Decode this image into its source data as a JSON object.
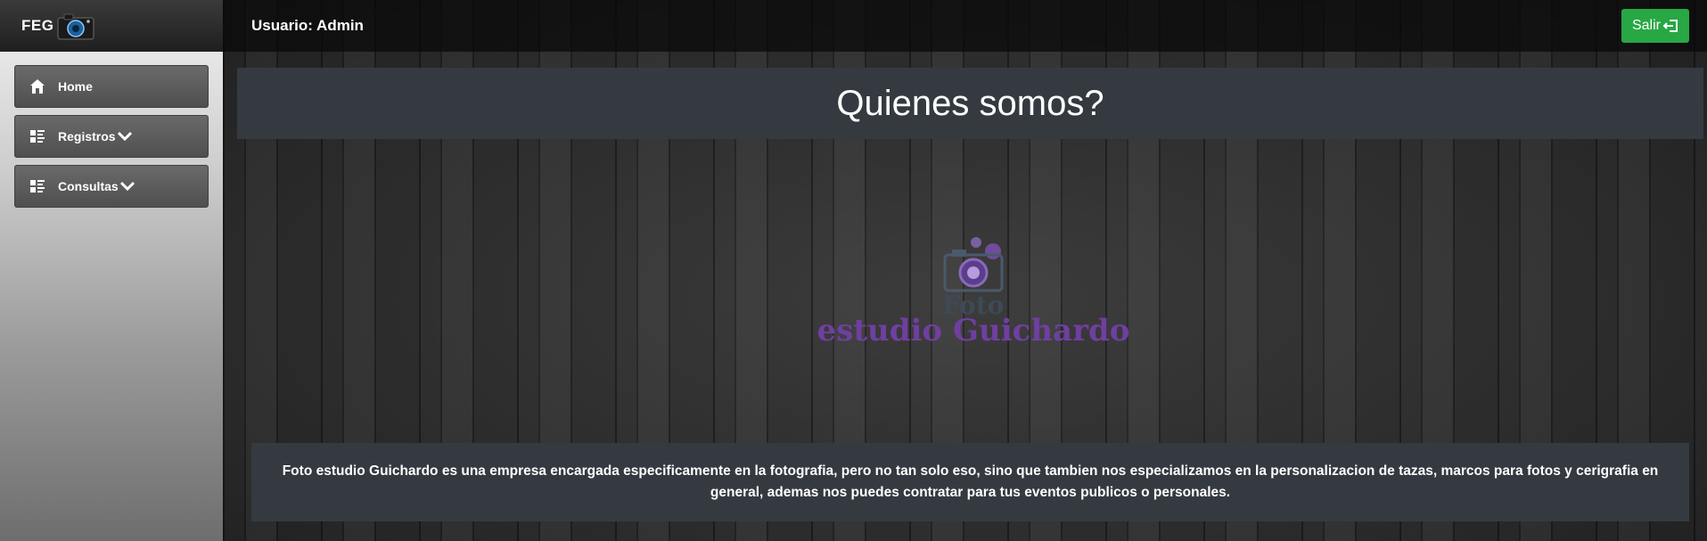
{
  "brand": {
    "name": "FEG",
    "camera_icon": "camera-icon"
  },
  "sidebar": {
    "items": [
      {
        "label": "Home",
        "icon": "home-icon"
      },
      {
        "label": "Registros",
        "icon": "list-icon",
        "chevron": "chevron-down-icon"
      },
      {
        "label": "Consultas",
        "icon": "list-icon",
        "chevron": "chevron-down-icon"
      }
    ]
  },
  "topbar": {
    "user_label": "Usuario: Admin",
    "logout_label": "Salir",
    "logout_icon": "sign-out-icon",
    "logout_color": "#28a745"
  },
  "main": {
    "title": "Quienes somos?",
    "logo": {
      "line1": "Foto",
      "line2": "estudio Guichardo",
      "color": "#6f3fa0"
    },
    "description": "Foto estudio Guichardo es una empresa encargada especificamente en la fotografia, pero no tan solo eso, sino que tambien nos especializamos en la personalizacion de tazas, marcos para fotos y cerigrafia en general, ademas nos puedes contratar para tus eventos publicos o personales."
  }
}
